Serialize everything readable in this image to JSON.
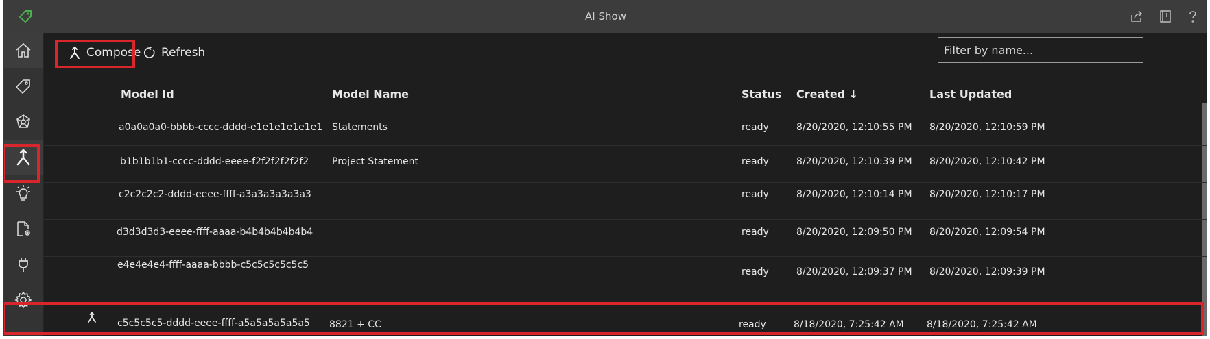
{
  "window": {
    "title": "AI Show"
  },
  "toolbar": {
    "compose_label": "Compose",
    "refresh_label": "Refresh"
  },
  "filter": {
    "placeholder": "Filter by name..."
  },
  "columns": {
    "model_id": "Model Id",
    "model_name": "Model Name",
    "status": "Status",
    "created": "Created ↓",
    "last_updated": "Last Updated"
  },
  "rows": [
    {
      "id": "a0a0a0a0-bbbb-cccc-dddd-e1e1e1e1e1e1",
      "name": "Statements",
      "status": "ready",
      "created": "8/20/2020, 12:10:55 PM",
      "updated": "8/20/2020, 12:10:59 PM"
    },
    {
      "id": "b1b1b1b1-cccc-dddd-eeee-f2f2f2f2f2f2",
      "name": "Project Statement",
      "status": "ready",
      "created": "8/20/2020, 12:10:39 PM",
      "updated": "8/20/2020, 12:10:42 PM"
    },
    {
      "id": "c2c2c2c2-dddd-eeee-ffff-a3a3a3a3a3a3",
      "name": "",
      "status": "ready",
      "created": "8/20/2020, 12:10:14 PM",
      "updated": "8/20/2020, 12:10:17 PM"
    },
    {
      "id": "d3d3d3d3-eeee-ffff-aaaa-b4b4b4b4b4b4",
      "name": "",
      "status": "ready",
      "created": "8/20/2020, 12:09:50 PM",
      "updated": "8/20/2020, 12:09:54 PM"
    },
    {
      "id": "e4e4e4e4-ffff-aaaa-bbbb-c5c5c5c5c5c5",
      "name": "",
      "status": "ready",
      "created": "8/20/2020, 12:09:37 PM",
      "updated": "8/20/2020, 12:09:39 PM"
    },
    {
      "id": "c5c5c5c5-dddd-eeee-ffff-a5a5a5a5a5a5",
      "name": "8821 + CC",
      "status": "ready",
      "created": "8/18/2020, 7:25:42 AM",
      "updated": "8/18/2020, 7:25:42 AM",
      "composed": true
    }
  ],
  "sidebar": {
    "items": [
      "home-icon",
      "tag-icon",
      "model-icon",
      "compose-icon",
      "lightbulb-icon",
      "document-settings-icon",
      "plug-icon",
      "gear-icon"
    ]
  },
  "colors": {
    "highlight": "#d9262c",
    "accent_green": "#4cae4c"
  }
}
